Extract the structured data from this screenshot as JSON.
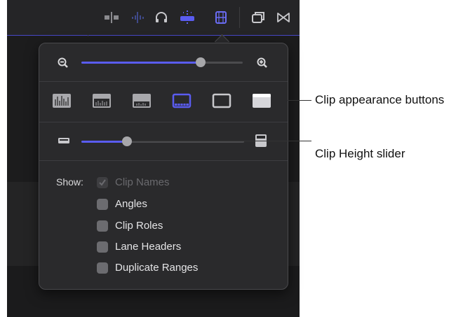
{
  "popover": {
    "zoom_slider": {
      "value": 0.74
    },
    "appearance_buttons": [
      {
        "icon": "waveform-only-icon",
        "selected": false
      },
      {
        "icon": "large-waveform-filmstrip-icon",
        "selected": false
      },
      {
        "icon": "waveform-filmstrip-icon",
        "selected": false
      },
      {
        "icon": "large-filmstrip-icon",
        "selected": true
      },
      {
        "icon": "filmstrip-only-icon",
        "selected": false
      },
      {
        "icon": "clip-labels-only-icon",
        "selected": false
      }
    ],
    "height_slider": {
      "value": 0.28
    },
    "show": {
      "label": "Show:",
      "options": [
        {
          "label": "Clip Names",
          "checked": true,
          "disabled": true
        },
        {
          "label": "Angles",
          "checked": false,
          "disabled": false
        },
        {
          "label": "Clip Roles",
          "checked": false,
          "disabled": false
        },
        {
          "label": "Lane Headers",
          "checked": false,
          "disabled": false
        },
        {
          "label": "Duplicate Ranges",
          "checked": false,
          "disabled": false
        }
      ]
    }
  },
  "callouts": {
    "appearance": "Clip appearance buttons",
    "height": "Clip Height slider"
  },
  "colors": {
    "accent": "#5a5cf0",
    "popover_bg": "#2a2a2c",
    "app_bg": "#1e1e1f"
  }
}
